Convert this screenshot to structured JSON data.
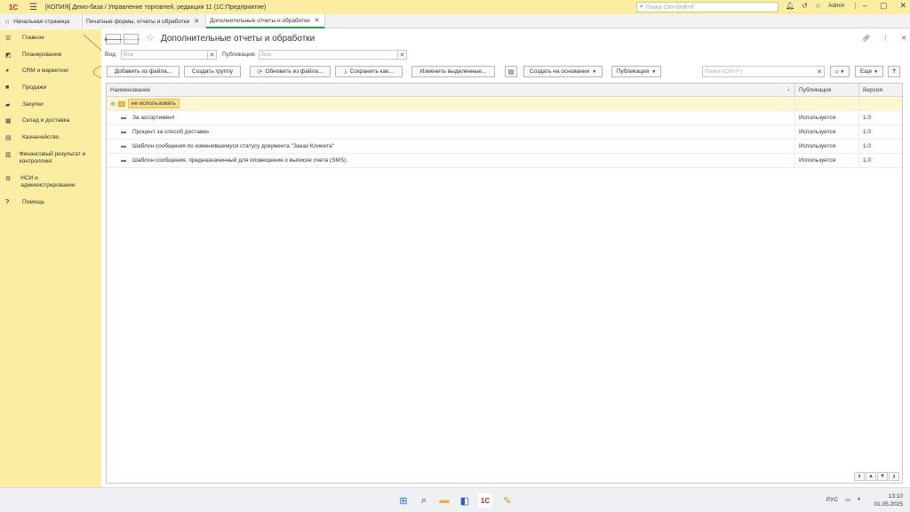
{
  "titlebar": {
    "logo": "1С",
    "title": "[КОПИЯ] Демо-база / Управление торговлей, редакция 11  (1С:Предприятие)",
    "search_placeholder": "Поиск Ctrl+Shift+F",
    "user": "Admin"
  },
  "tabs": [
    {
      "label": "Начальная страница"
    },
    {
      "label": "Печатные формы, отчеты и обработки"
    },
    {
      "label": "Дополнительные отчеты и обработки"
    }
  ],
  "sidebar": {
    "items": [
      {
        "label": "Главное"
      },
      {
        "label": "Планирование"
      },
      {
        "label": "CRM и маркетинг"
      },
      {
        "label": "Продажи"
      },
      {
        "label": "Закупки"
      },
      {
        "label": "Склад и доставка"
      },
      {
        "label": "Казначейство"
      },
      {
        "label": "Финансовый результат и контроллинг"
      },
      {
        "label": "НСИ и администрирование"
      },
      {
        "label": "Помощь"
      }
    ]
  },
  "page": {
    "title": "Дополнительные отчеты и обработки"
  },
  "filters": {
    "vid_label": "Вид:",
    "vid_value": "Все",
    "pub_label": "Публикация:",
    "pub_value": "Все"
  },
  "toolbar": {
    "add_from_file": "Добавить из файла...",
    "create_group": "Создать группу",
    "update_from_file": "Обновить из файла...",
    "save_as": "Сохранить как...",
    "change_selected": "Изменить выделенные...",
    "create_based": "Создать на основании",
    "publication": "Публикация",
    "search_placeholder": "Поиск (Ctrl+F)",
    "more": "Еще"
  },
  "table": {
    "headers": {
      "name": "Наименование",
      "pub": "Публикация",
      "ver": "Версия"
    },
    "group": "не использовать",
    "rows": [
      {
        "name": "За ассортимент",
        "pub": "Используется",
        "ver": "1.0"
      },
      {
        "name": "Процент за способ доставки",
        "pub": "Используется",
        "ver": "1.0"
      },
      {
        "name": "Шаблон сообщения по изменившемуся статусу документа \"Заказ Клиента\"",
        "pub": "Используется",
        "ver": "1.0"
      },
      {
        "name": "Шаблон сообщения, предназначенный для оповещения о выписке счета (SMS).",
        "pub": "Используется",
        "ver": "1.0"
      }
    ]
  },
  "taskbar": {
    "lang": "РУС",
    "time": "13:10",
    "date": "01.05.2025"
  }
}
